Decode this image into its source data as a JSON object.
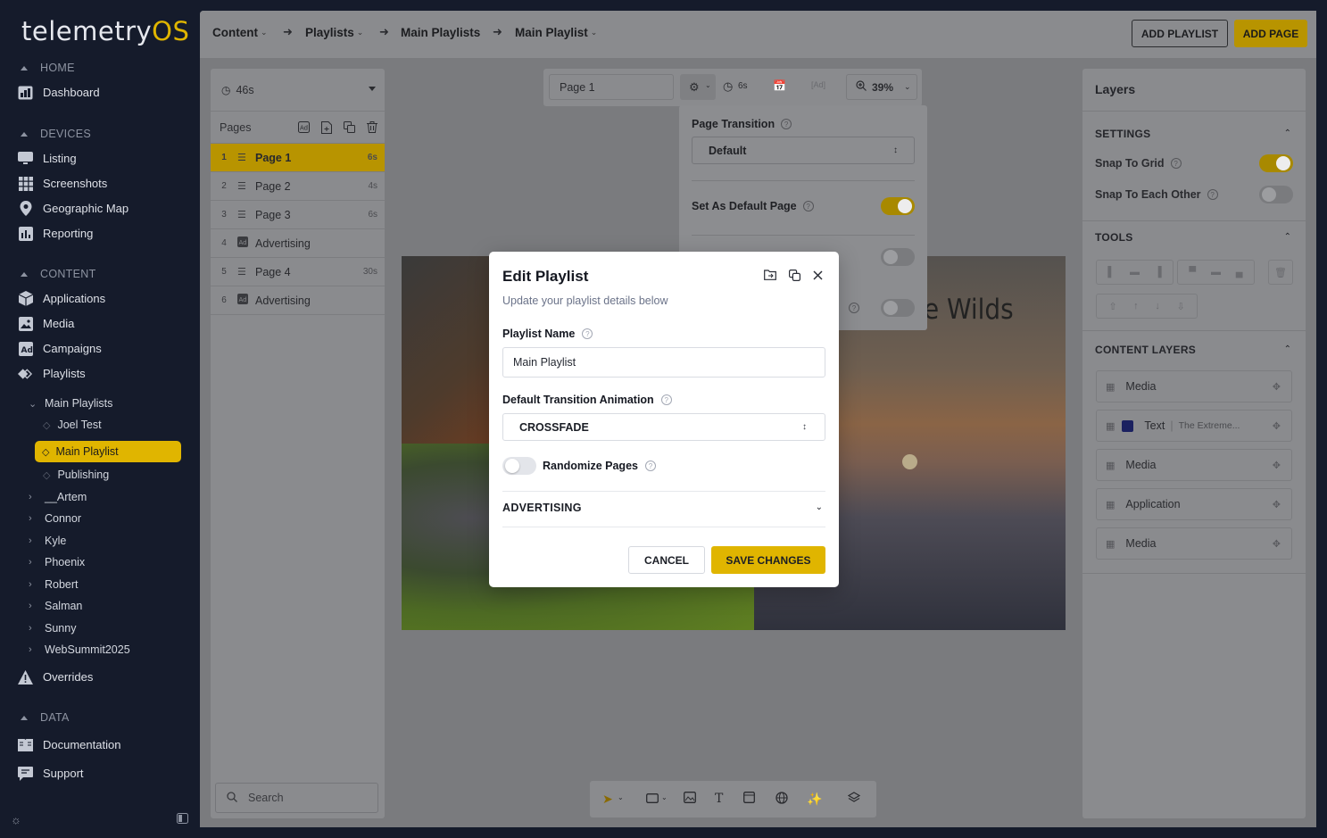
{
  "app": {
    "logo_main": "telemetry",
    "logo_accent": "OS"
  },
  "sidebar": {
    "sections": {
      "home": "HOME",
      "devices": "DEVICES",
      "content": "CONTENT",
      "data": "DATA"
    },
    "home_items": [
      {
        "label": "Dashboard",
        "icon": "dashboard-icon"
      }
    ],
    "device_items": [
      {
        "label": "Listing",
        "icon": "monitor-icon"
      },
      {
        "label": "Screenshots",
        "icon": "grid-icon"
      },
      {
        "label": "Geographic Map",
        "icon": "map-pin-icon"
      },
      {
        "label": "Reporting",
        "icon": "chart-icon"
      }
    ],
    "content_items": [
      {
        "label": "Applications",
        "icon": "cube-icon"
      },
      {
        "label": "Media",
        "icon": "image-icon"
      },
      {
        "label": "Campaigns",
        "icon": "ad-icon"
      },
      {
        "label": "Playlists",
        "icon": "playlist-icon"
      }
    ],
    "tree": {
      "main_playlists": "Main Playlists",
      "joel_test": "Joel Test",
      "main_playlist": "Main Playlist",
      "publishing": "Publishing",
      "folders": [
        "__Artem",
        "Connor",
        "Kyle",
        "Phoenix",
        "Robert",
        "Salman",
        "Sunny",
        "WebSummit2025"
      ]
    },
    "overrides": "Overrides",
    "data_items": [
      {
        "label": "Documentation",
        "icon": "book-icon"
      },
      {
        "label": "Support",
        "icon": "chat-icon"
      }
    ]
  },
  "header": {
    "breadcrumbs": [
      "Content",
      "Playlists",
      "Main Playlists",
      "Main Playlist"
    ],
    "add_playlist": "ADD PLAYLIST",
    "add_page": "ADD PAGE"
  },
  "pages_panel": {
    "duration": "46s",
    "title": "Pages",
    "pages": [
      {
        "num": "1",
        "name": "Page 1",
        "dur": "6s",
        "kind": "layers"
      },
      {
        "num": "2",
        "name": "Page 2",
        "dur": "4s",
        "kind": "layers"
      },
      {
        "num": "3",
        "name": "Page 3",
        "dur": "6s",
        "kind": "layers"
      },
      {
        "num": "4",
        "name": "Advertising",
        "dur": "",
        "kind": "ad"
      },
      {
        "num": "5",
        "name": "Page 4",
        "dur": "30s",
        "kind": "layers"
      },
      {
        "num": "6",
        "name": "Advertising",
        "dur": "",
        "kind": "ad"
      }
    ],
    "search_placeholder": "Search"
  },
  "canvas_toolbar": {
    "page_name": "Page 1",
    "duration": "6s",
    "zoom": "39%"
  },
  "settings_dropdown": {
    "page_transition_label": "Page Transition",
    "page_transition_value": "Default",
    "default_page_label": "Set As Default Page",
    "default_page_on": true
  },
  "canvas": {
    "visible_text": "e Wilds"
  },
  "layers_panel": {
    "title": "Layers",
    "settings_title": "SETTINGS",
    "snap_grid": "Snap To Grid",
    "snap_grid_on": true,
    "snap_each": "Snap To Each Other",
    "snap_each_on": false,
    "tools_title": "TOOLS",
    "content_layers_title": "CONTENT LAYERS",
    "layers": [
      {
        "label": "Media",
        "detail": ""
      },
      {
        "label": "Text",
        "detail": "The Extreme..."
      },
      {
        "label": "Media",
        "detail": ""
      },
      {
        "label": "Application",
        "detail": ""
      },
      {
        "label": "Media",
        "detail": ""
      }
    ]
  },
  "modal": {
    "title": "Edit Playlist",
    "subtitle": "Update your playlist details below",
    "name_label": "Playlist Name",
    "name_value": "Main Playlist",
    "transition_label": "Default Transition Animation",
    "transition_value": "CROSSFADE",
    "randomize_label": "Randomize Pages",
    "randomize_on": false,
    "advertising_label": "ADVERTISING",
    "cancel": "CANCEL",
    "save": "SAVE CHANGES"
  },
  "colors": {
    "accent": "#e0b500",
    "sidebar_bg": "#151b2b",
    "overlay": "#7a7b7e"
  }
}
